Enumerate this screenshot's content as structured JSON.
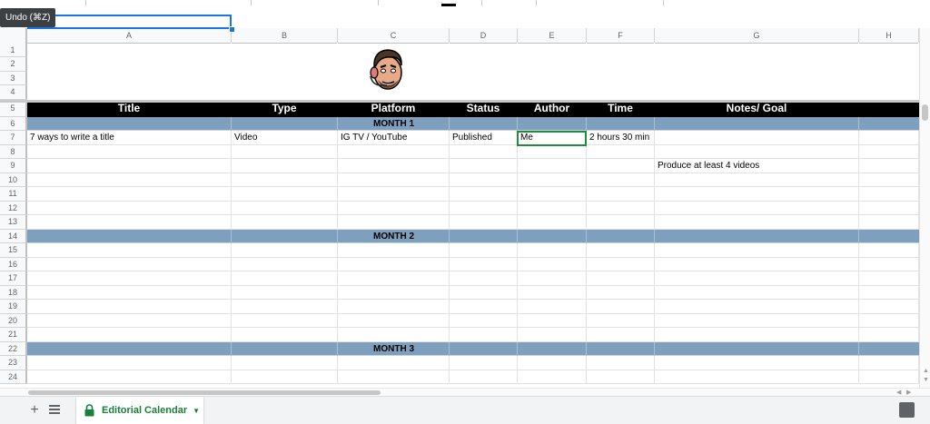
{
  "tooltip": {
    "text": "Undo (⌘Z)"
  },
  "columns": [
    "A",
    "B",
    "C",
    "D",
    "E",
    "F",
    "G",
    "H"
  ],
  "row_numbers": [
    "1",
    "2",
    "3",
    "4",
    "5",
    "6",
    "7",
    "8",
    "9",
    "10",
    "11",
    "12",
    "13",
    "14",
    "15",
    "16",
    "17",
    "18",
    "19",
    "20",
    "21",
    "22",
    "23",
    "24"
  ],
  "header_row": [
    "Title",
    "Type",
    "Platform",
    "Status",
    "Author",
    "Time",
    "Notes/ Goal",
    ""
  ],
  "month_labels": {
    "month1": "MONTH 1",
    "month2": "MONTH 2",
    "month3": "MONTH 3"
  },
  "row7": [
    "7 ways to write a title",
    "Video",
    "IG TV / YouTube",
    "Published",
    "Me",
    "2 hours 30 min",
    "",
    ""
  ],
  "row9": {
    "notes": "Produce at least 4 videos"
  },
  "sheet_tab": {
    "name": "Editorial Calendar"
  },
  "colors": {
    "header_bg": "#000000",
    "month_band": "#7f9fbf",
    "selection_blue": "#1a73e8",
    "selection_green": "#1e8e3e",
    "tab_text": "#188038"
  },
  "icons": [
    "add-sheet-icon",
    "all-sheets-icon",
    "lock-icon",
    "caret-down-icon",
    "explore-icon",
    "avatar-image"
  ]
}
